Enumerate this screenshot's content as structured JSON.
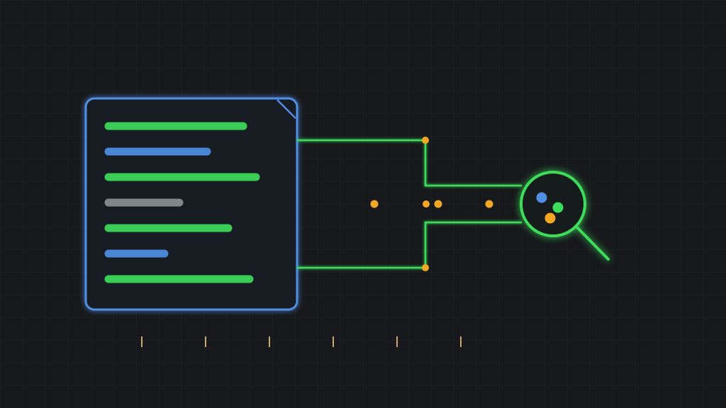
{
  "colors": {
    "background": "#16181b",
    "grid": "#22252a",
    "document_blue": "#4f8fe6",
    "line_green": "#3ddc5a",
    "line_blue": "#4f8fe6",
    "text_gray": "#8a8f96",
    "node_orange": "#f5a623"
  },
  "document": {
    "icon": "document-icon",
    "lines": [
      {
        "color": "green",
        "length": 0.67
      },
      {
        "color": "blue",
        "length": 0.5
      },
      {
        "color": "green",
        "length": 0.73
      },
      {
        "color": "gray",
        "length": 0.37
      },
      {
        "color": "green",
        "length": 0.6
      },
      {
        "color": "blue",
        "length": 0.3
      },
      {
        "color": "green",
        "length": 0.7
      }
    ]
  },
  "connectors": {
    "top_branch": "green",
    "middle_branch": "blue",
    "bottom_branch": "green",
    "middle_nodes": 4
  },
  "magnifier": {
    "icon": "magnifier-icon",
    "dots": [
      "blue",
      "green",
      "orange"
    ]
  },
  "timeline": {
    "ticks": 6
  }
}
